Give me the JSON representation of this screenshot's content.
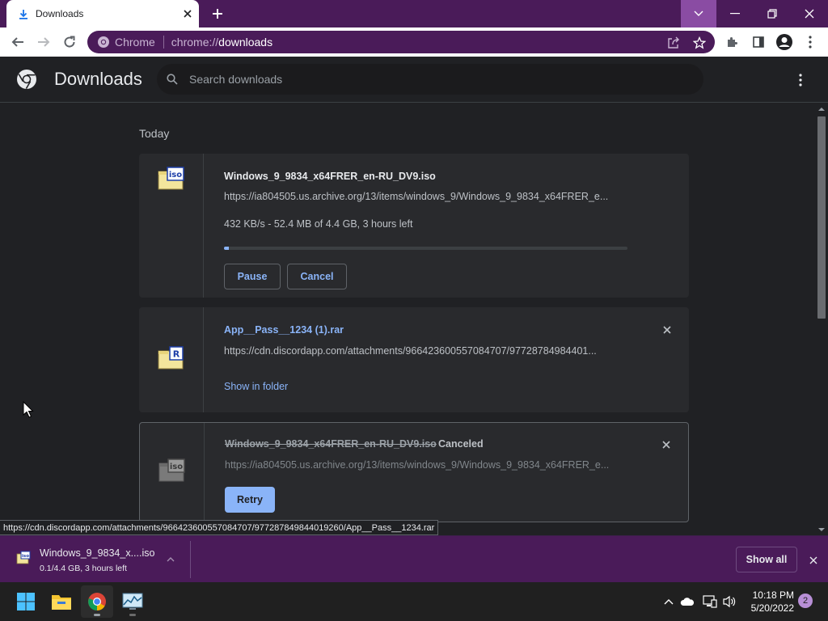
{
  "browser": {
    "tab": {
      "title": "Downloads",
      "icon": "download-icon"
    },
    "omnibox": {
      "chip_label": "Chrome",
      "url_scheme": "chrome://",
      "url_host": "downloads"
    }
  },
  "page": {
    "title": "Downloads",
    "search_placeholder": "Search downloads",
    "section_label": "Today",
    "downloads": [
      {
        "file_name": "Windows_9_9834_x64FRER_en-RU_DV9.iso",
        "url": "https://ia804505.us.archive.org/13/items/windows_9/Windows_9_9834_x64FRER_e...",
        "status": "432 KB/s - 52.4 MB of 4.4 GB, 3 hours left",
        "progress": 0.012,
        "icon": "iso-file-icon",
        "actions": [
          "Pause",
          "Cancel"
        ]
      },
      {
        "file_name": "App__Pass__1234 (1).rar",
        "url": "https://cdn.discordapp.com/attachments/966423600557084707/97728784984401...",
        "link": "Show in folder",
        "icon": "rar-file-icon"
      },
      {
        "file_name": "Windows_9_9834_x64FRER_en-RU_DV9.iso",
        "state": "Canceled",
        "url": "https://ia804505.us.archive.org/13/items/windows_9/Windows_9_9834_x64FRER_e...",
        "action": "Retry",
        "icon": "iso-file-icon"
      }
    ],
    "hover_url": "https://cdn.discordapp.com/attachments/966423600557084707/977287849844019260/App__Pass__1234.rar"
  },
  "shelf": {
    "item_name": "Windows_9_9834_x....iso",
    "item_status": "0.1/4.4 GB, 3 hours left",
    "show_all_label": "Show all"
  },
  "taskbar": {
    "time": "10:18 PM",
    "date": "5/20/2022",
    "notifications": "2"
  },
  "colors": {
    "frame": "#4a1b59",
    "accent": "#8ab4f8",
    "page_bg": "#202124",
    "card_bg": "#292a2d"
  }
}
